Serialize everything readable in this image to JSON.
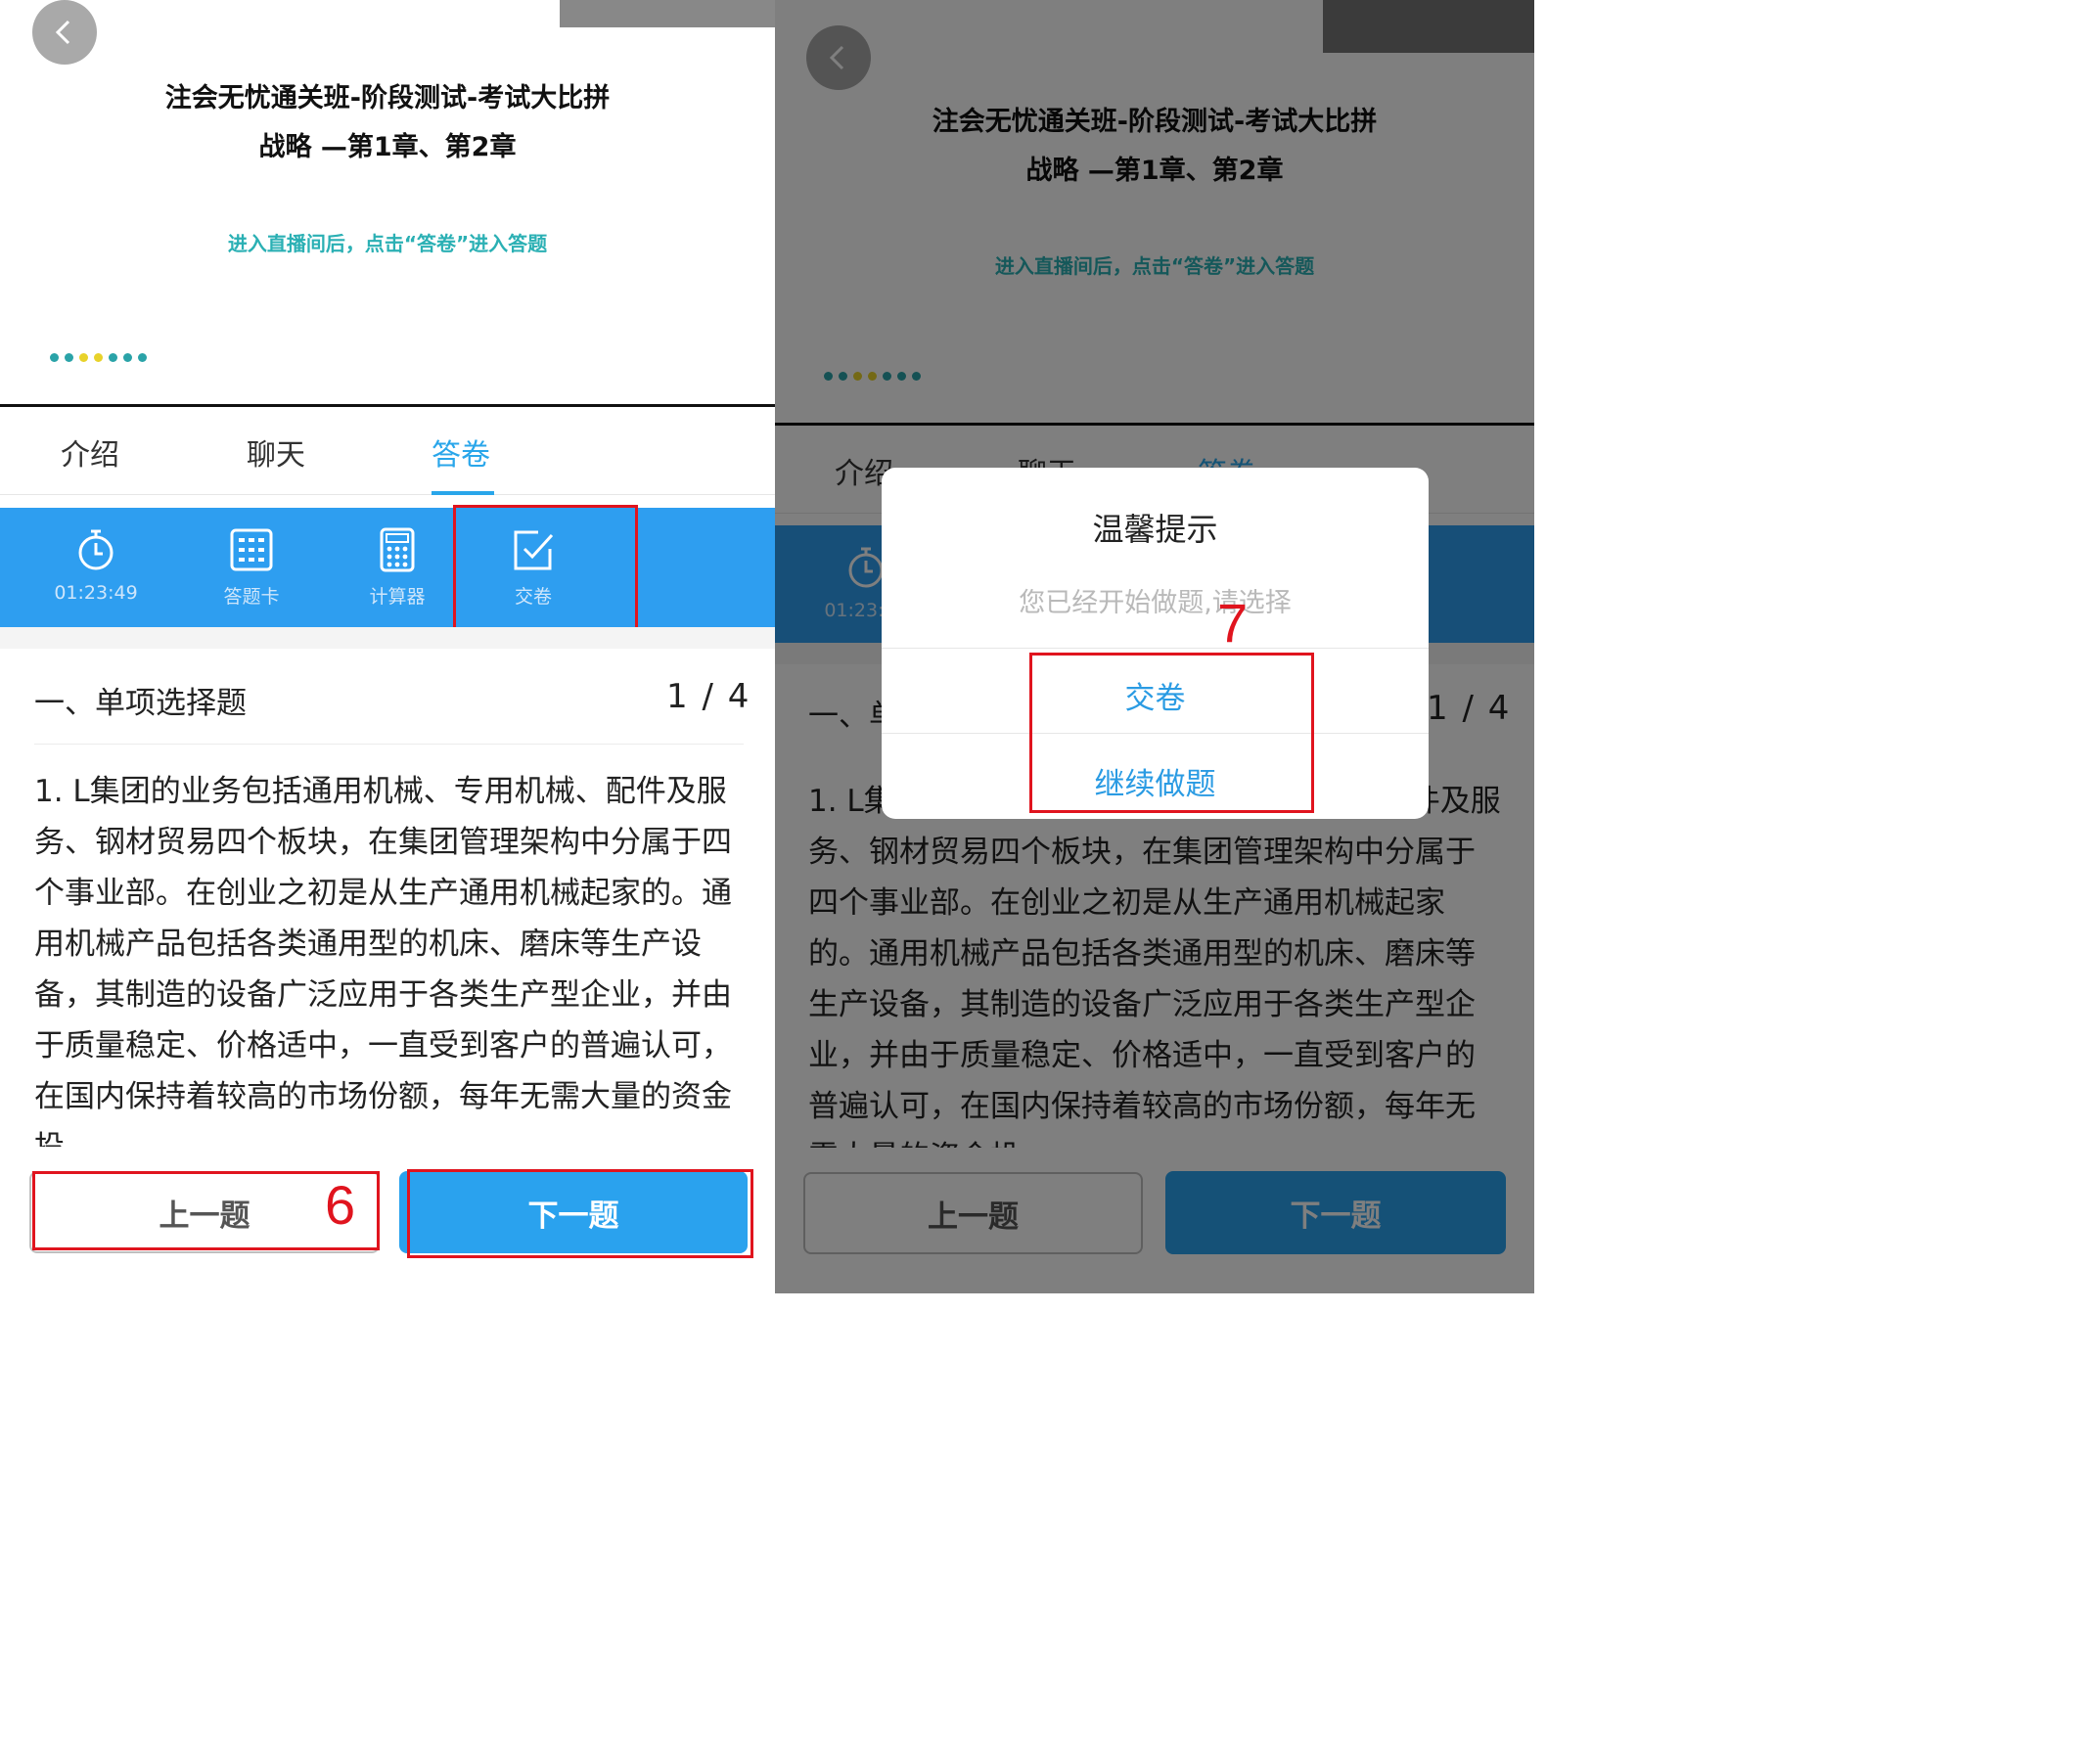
{
  "screens": [
    {
      "id": "before",
      "hero": {
        "title_line1": "注会无忧通关班-阶段测试-考试大比拼",
        "title_line2": "战略 —第1章、第2章",
        "hint": "进入直播间后，点击“答卷”进入答题"
      },
      "tabs": [
        {
          "label": "介绍",
          "active": false
        },
        {
          "label": "聊天",
          "active": false
        },
        {
          "label": "答卷",
          "active": true
        }
      ],
      "toolbar": [
        {
          "icon": "stopwatch-icon",
          "label": "01:23:49"
        },
        {
          "icon": "answer-card-icon",
          "label": "答题卡"
        },
        {
          "icon": "calculator-icon",
          "label": "计算器"
        },
        {
          "icon": "submit-check-icon",
          "label": "交卷"
        }
      ],
      "question": {
        "section": "一、单项选择题",
        "counter": "1 / 4",
        "text": "1. L集团的业务包括通用机械、专用机械、配件及服务、钢材贸易四个板块，在集团管理架构中分属于四个事业部。在创业之初是从生产通用机械起家的。通用机械产品包括各类通用型的机床、磨床等生产设备，其制造的设备广泛应用于各类生产型企业，并由于质量稳定、价格适中，一直受到客户的普遍认可，在国内保持着较高的市场份额，每年无需大量的资金投"
      },
      "buttons": {
        "prev": "上一题",
        "next": "下一题"
      },
      "annotation": "6"
    },
    {
      "id": "after",
      "hero": {
        "title_line1": "注会无忧通关班-阶段测试-考试大比拼",
        "title_line2": "战略 —第1章、第2章",
        "hint": "进入直播间后，点击“答卷”进入答题"
      },
      "tabs": [
        {
          "label": "介绍",
          "active": false
        },
        {
          "label": "聊天",
          "active": false
        },
        {
          "label": "答卷",
          "active": true
        }
      ],
      "toolbar": [
        {
          "icon": "stopwatch-icon",
          "label": "01:23:49"
        }
      ],
      "question": {
        "section": "一、单项选择题",
        "counter": "1 / 4",
        "text": "1. L集团的业务包括通用机械、专用机械、配件及服务、钢材贸易四个板块，在集团管理架构中分属于四个事业部。在创业之初是从生产通用机械起家的。通用机械产品包括各类通用型的机床、磨床等生产设备，其制造的设备广泛应用于各类生产型企业，并由于质量稳定、价格适中，一直受到客户的普遍认可，在国内保持着较高的市场份额，每年无需大量的资金投"
      },
      "buttons": {
        "prev": "上一题",
        "next": "下一题"
      },
      "dialog": {
        "title": "温馨提示",
        "message": "您已经开始做题,请选择",
        "submit": "交卷",
        "continue": "继续做题"
      },
      "annotation": "7"
    }
  ],
  "colors": {
    "accent": "#2e9ef0",
    "tab_active": "#29a6ea",
    "hint_teal": "#2bb0b4",
    "annotation_red": "#e0141e",
    "dialog_link": "#2a9be3"
  }
}
